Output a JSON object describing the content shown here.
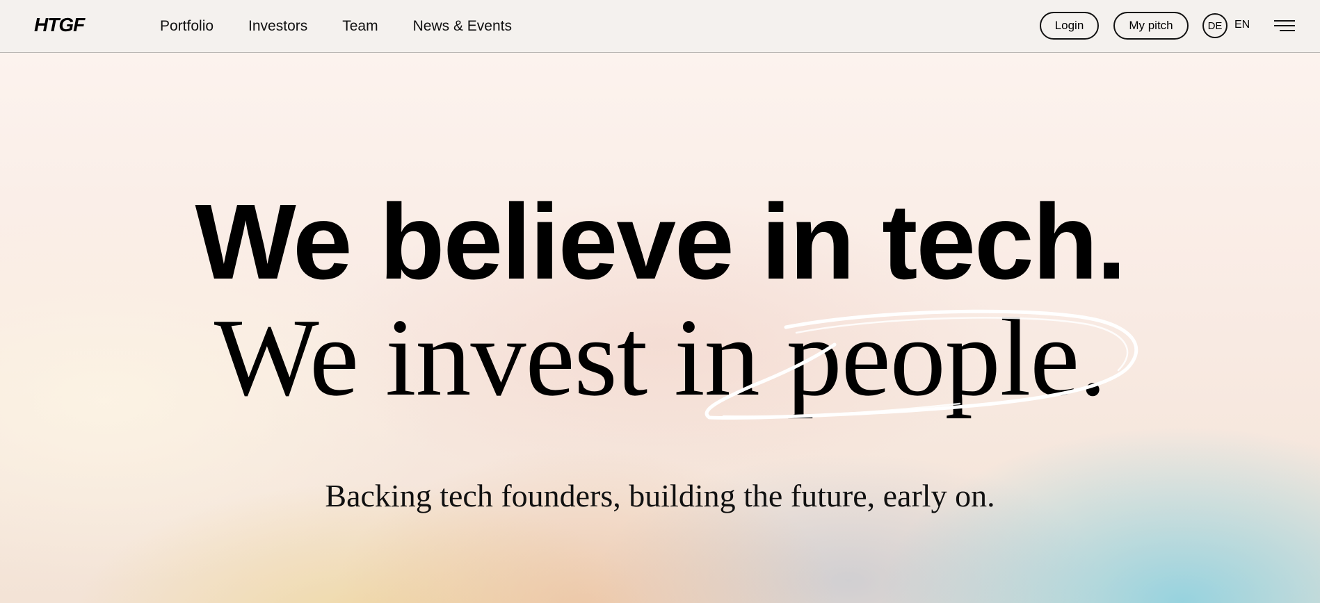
{
  "header": {
    "logo": "HTGF",
    "nav": [
      "Portfolio",
      "Investors",
      "Team",
      "News & Events"
    ],
    "login_label": "Login",
    "pitch_label": "My pitch",
    "lang_de": "DE",
    "lang_en": "EN",
    "menu_icon": "hamburger-menu-icon"
  },
  "hero": {
    "headline_1": "We believe in tech.",
    "headline_2": "We invest in people.",
    "subline": "Backing tech founders, building the future, early on.",
    "scribble_icon": "hand-drawn-circle-icon"
  },
  "colors": {
    "text": "#000000",
    "header_bg": "#f4f1ee",
    "gradient_peach": "#e8b48c",
    "gradient_yellow": "#eed696",
    "gradient_cyan": "#78cde1"
  }
}
